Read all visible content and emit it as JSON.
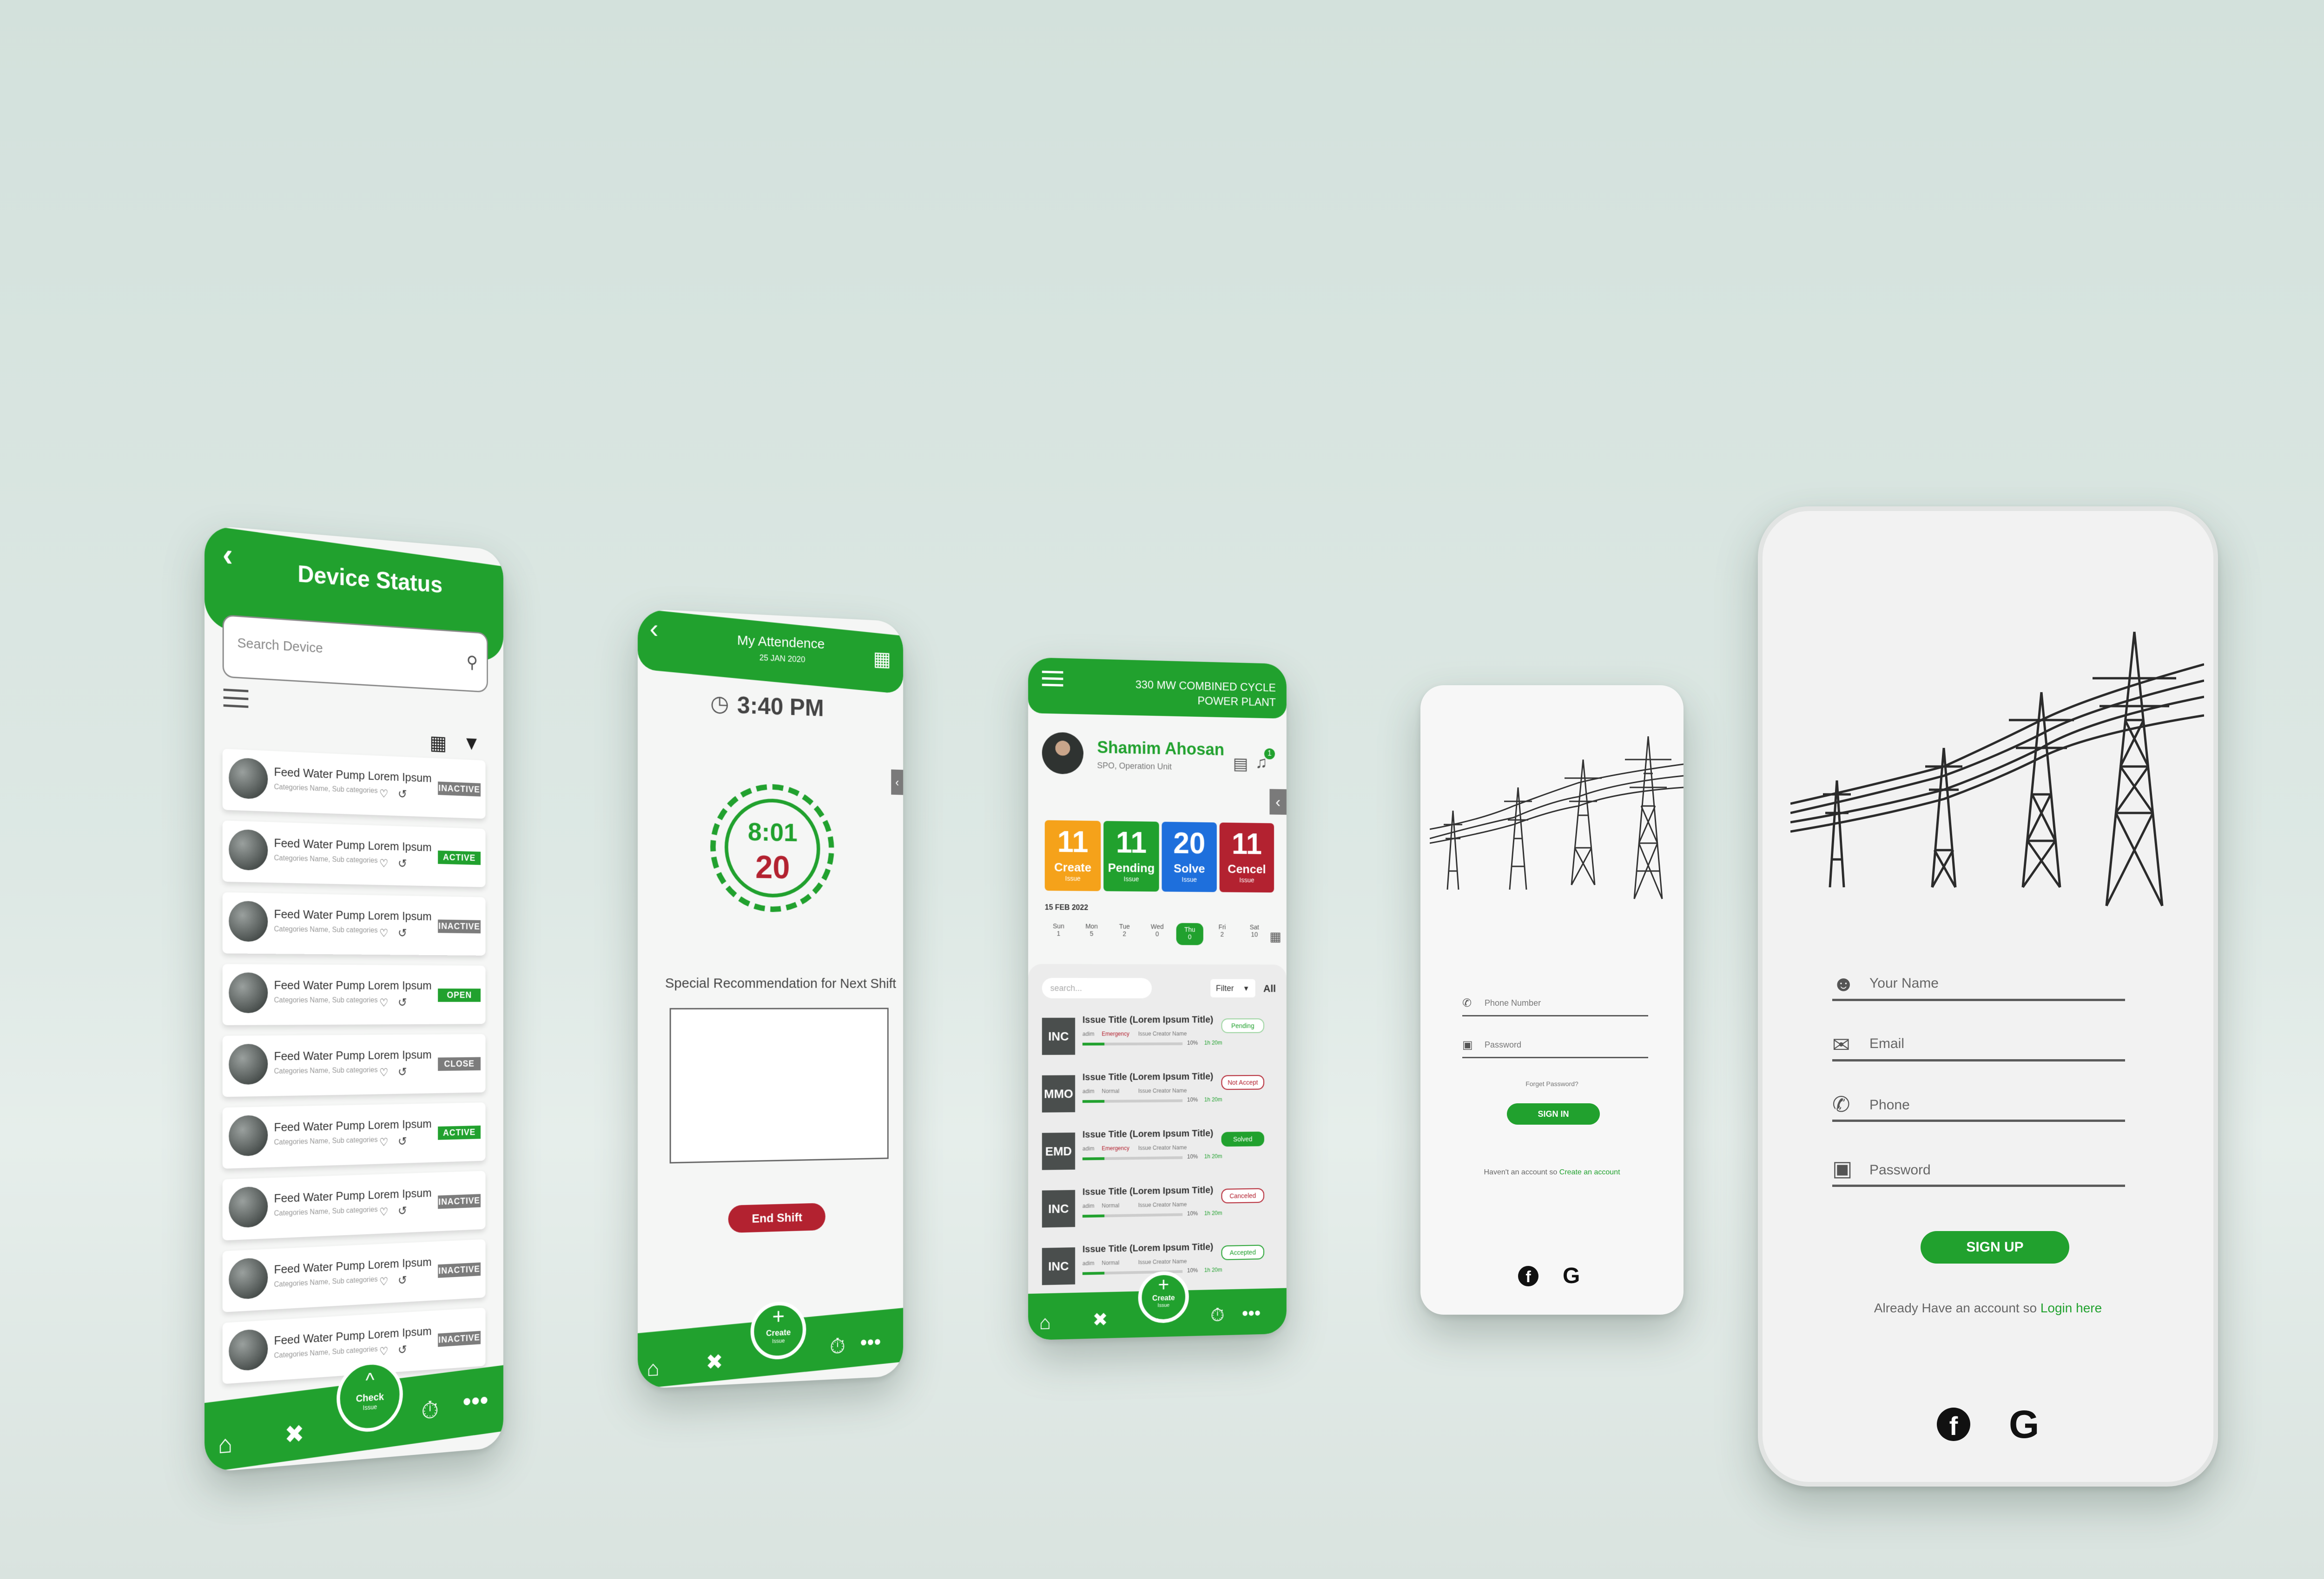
{
  "colors": {
    "green": "#21a12e",
    "red": "#b32230",
    "orange": "#f5a21a",
    "blue": "#1e6fdc",
    "gray": "#7c7c7c"
  },
  "device": {
    "title": "Device Status",
    "search_placeholder": "Search Device",
    "rows": [
      {
        "name": "Feed Water Pump Lorem Ipsum",
        "sub": "Categories Name, Sub categories",
        "status": "INACTIVE"
      },
      {
        "name": "Feed Water Pump Lorem Ipsum",
        "sub": "Categories Name, Sub categories",
        "status": "ACTIVE"
      },
      {
        "name": "Feed Water Pump Lorem Ipsum",
        "sub": "Categories Name, Sub categories",
        "status": "INACTIVE"
      },
      {
        "name": "Feed Water Pump Lorem Ipsum",
        "sub": "Categories Name, Sub categories",
        "status": "OPEN"
      },
      {
        "name": "Feed Water Pump Lorem Ipsum",
        "sub": "Categories Name, Sub categories",
        "status": "CLOSE"
      },
      {
        "name": "Feed Water Pump Lorem Ipsum",
        "sub": "Categories Name, Sub categories",
        "status": "ACTIVE"
      },
      {
        "name": "Feed Water Pump Lorem Ipsum",
        "sub": "Categories Name, Sub categories",
        "status": "INACTIVE"
      },
      {
        "name": "Feed Water Pump Lorem Ipsum",
        "sub": "Categories Name, Sub categories",
        "status": "INACTIVE"
      },
      {
        "name": "Feed Water Pump Lorem Ipsum",
        "sub": "Categories Name, Sub categories",
        "status": "INACTIVE"
      }
    ],
    "fab_label": "Check",
    "fab_sub": "Issue"
  },
  "attendance": {
    "title": "My Attendence",
    "date": "25 JAN 2020",
    "time": "3:40 PM",
    "timer_top": "8:01",
    "timer_bottom": "20",
    "recommendation_label": "Special Recommendation for Next Shift",
    "end_shift": "End Shift",
    "fab_label": "Create",
    "fab_sub": "Issue"
  },
  "dashboard": {
    "plant_line1": "330 MW COMBINED CYCLE",
    "plant_line2": "POWER PLANT",
    "user_name": "Shamim Ahosan",
    "user_role": "SPO, Operation Unit",
    "notif_count": "1",
    "stats": [
      {
        "value": "11",
        "label": "Create",
        "sub": "Issue"
      },
      {
        "value": "11",
        "label": "Pending",
        "sub": "Issue"
      },
      {
        "value": "20",
        "label": "Solve",
        "sub": "Issue"
      },
      {
        "value": "11",
        "label": "Cencel",
        "sub": "Issue"
      }
    ],
    "date": "15 FEB 2022",
    "days": [
      {
        "d": "Sun",
        "n": "1"
      },
      {
        "d": "Mon",
        "n": "5"
      },
      {
        "d": "Tue",
        "n": "2"
      },
      {
        "d": "Wed",
        "n": "0"
      },
      {
        "d": "Thu",
        "n": "0"
      },
      {
        "d": "Fri",
        "n": "2"
      },
      {
        "d": "Sat",
        "n": "10"
      }
    ],
    "search_placeholder": "search...",
    "filter_label": "Filter",
    "all_label": "All",
    "issues": [
      {
        "code": "INC",
        "title": "Issue Title (Lorem Ipsum Title)",
        "user": "adim",
        "priority": "Emergency",
        "creator": "Issue Creator Name",
        "pct": "10%",
        "time": "1h 20m",
        "status": "Pending"
      },
      {
        "code": "MMO",
        "title": "Issue Title (Lorem Ipsum Title)",
        "user": "adim",
        "priority": "Normal",
        "creator": "Issue Creator Name",
        "pct": "10%",
        "time": "1h 20m",
        "status": "Not Accept"
      },
      {
        "code": "EMD",
        "title": "Issue Title (Lorem Ipsum Title)",
        "user": "adim",
        "priority": "Emergency",
        "creator": "Issue Creator Name",
        "pct": "10%",
        "time": "1h 20m",
        "status": "Solved"
      },
      {
        "code": "INC",
        "title": "Issue Title (Lorem Ipsum Title)",
        "user": "adim",
        "priority": "Normal",
        "creator": "Issue Creator Name",
        "pct": "10%",
        "time": "1h 20m",
        "status": "Canceled"
      },
      {
        "code": "INC",
        "title": "Issue Title (Lorem Ipsum Title)",
        "user": "adim",
        "priority": "Normal",
        "creator": "Issue Creator Name",
        "pct": "10%",
        "time": "1h 20m",
        "status": "Accepted"
      }
    ],
    "fab_label": "Create",
    "fab_sub": "Issue"
  },
  "signin": {
    "phone_placeholder": "Phone Number",
    "password_placeholder": "Password",
    "forgot": "Forget Password?",
    "button": "SIGN IN",
    "no_account": "Haven't an account so",
    "create_link": "Create an account"
  },
  "signup": {
    "name_placeholder": "Your Name",
    "email_placeholder": "Email",
    "phone_placeholder": "Phone",
    "password_placeholder": "Password",
    "button": "SIGN UP",
    "have_account": "Already Have an account so",
    "login_link": "Login here"
  }
}
